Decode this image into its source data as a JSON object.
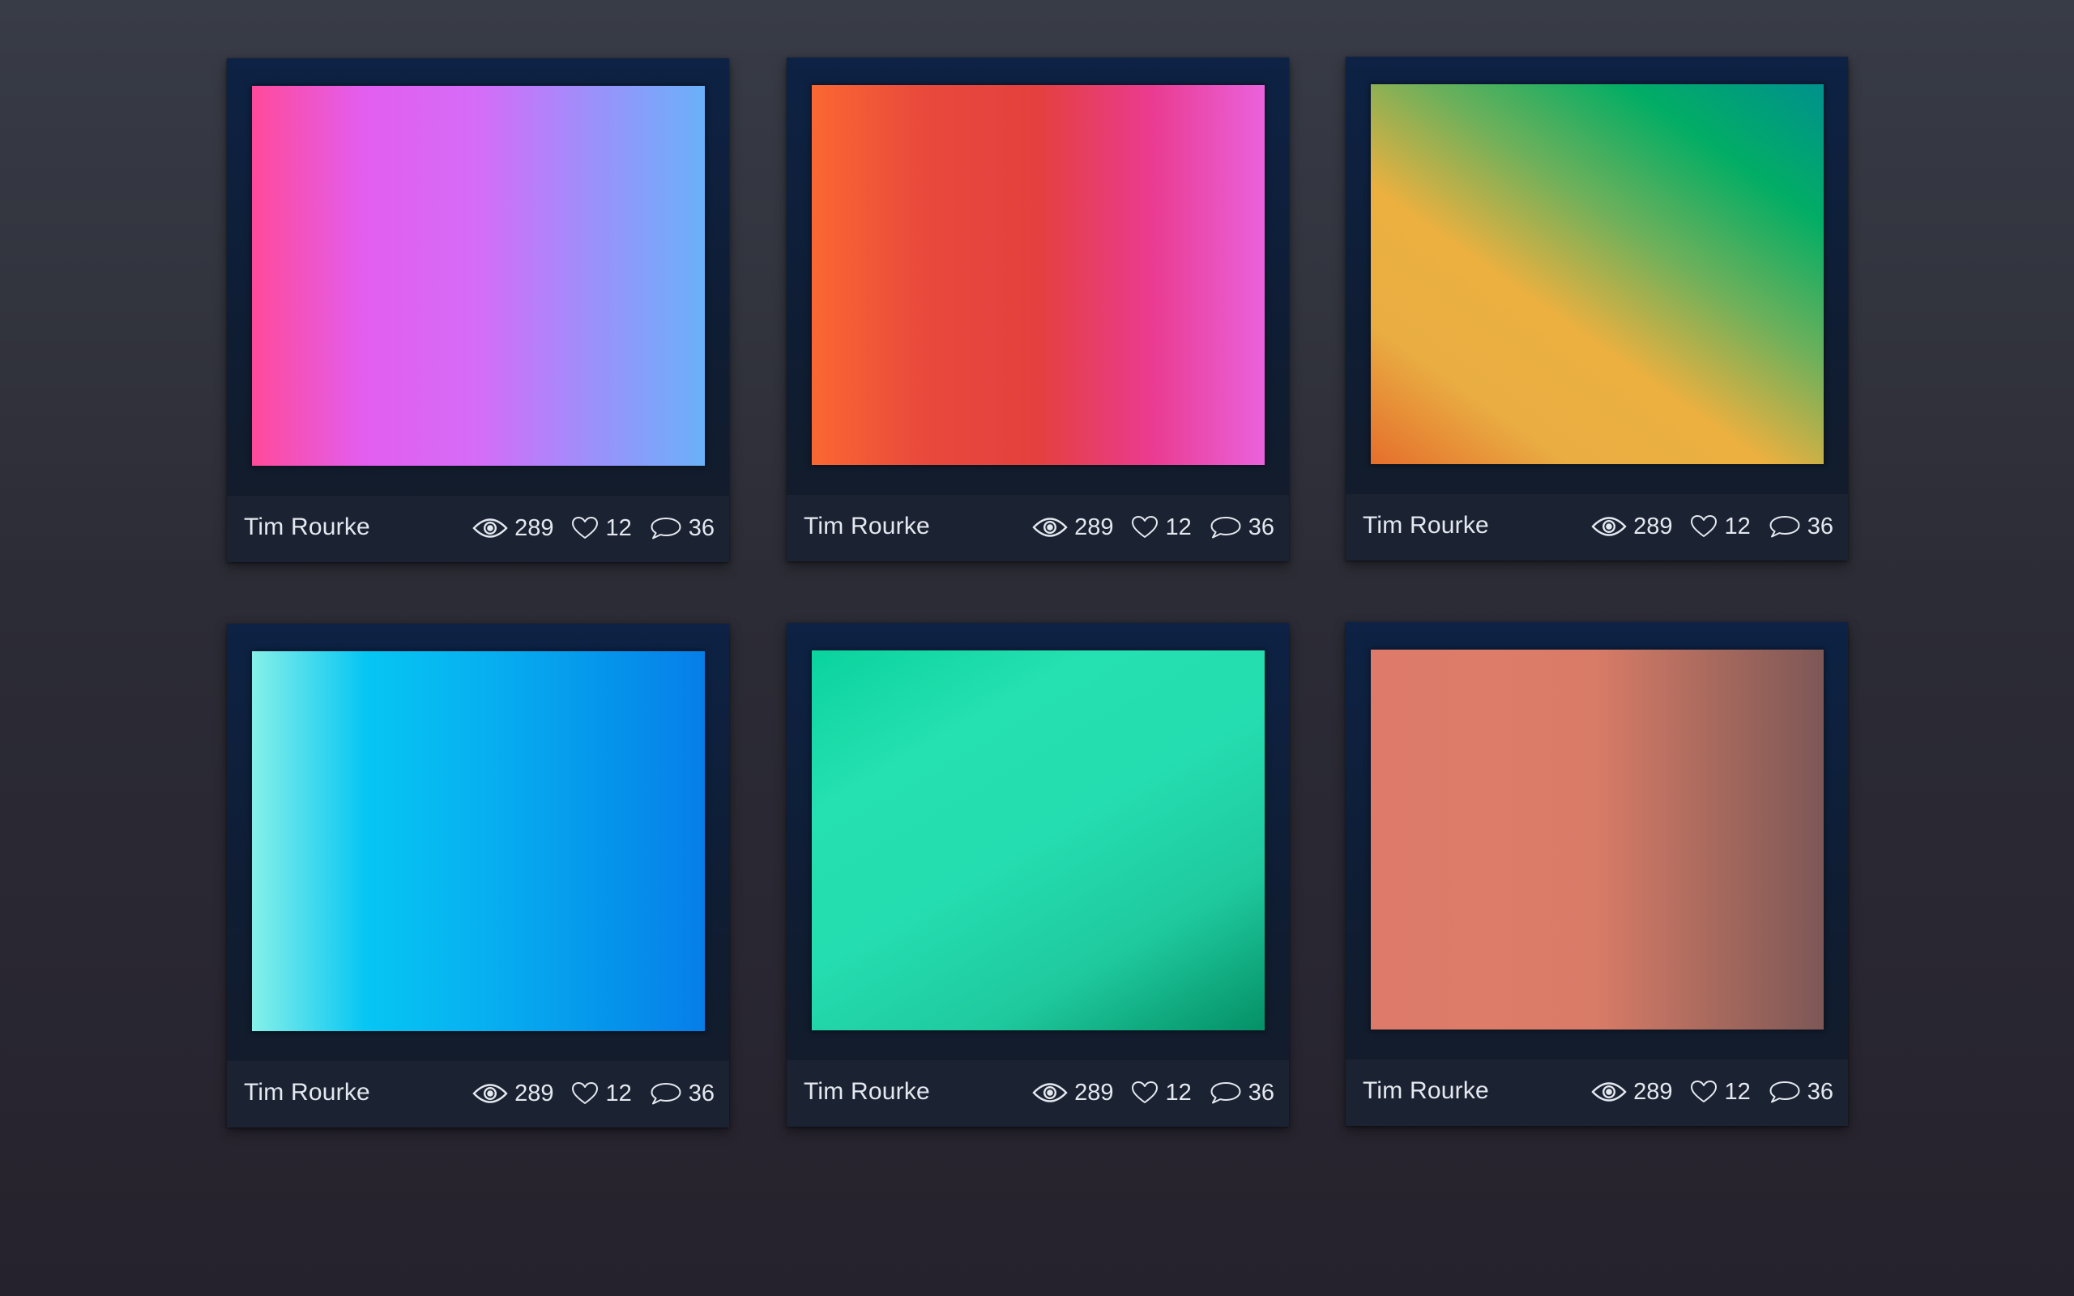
{
  "cards": [
    {
      "author": "Tim Rourke",
      "views": "289",
      "likes": "12",
      "comments": "36",
      "gradient": {
        "angle": "90deg",
        "colors": [
          "#ff4a9a",
          "#e25ef0",
          "#d56cf7",
          "#9c90fb",
          "#6ab1f9"
        ]
      }
    },
    {
      "author": "Tim Rourke",
      "views": "289",
      "likes": "12",
      "comments": "36",
      "gradient": {
        "angle": "90deg",
        "colors": [
          "#fb6733",
          "#e8493c",
          "#e4403f",
          "#ea3b90",
          "#ea62dd"
        ]
      }
    },
    {
      "author": "Tim Rourke",
      "views": "289",
      "likes": "12",
      "comments": "36",
      "gradient": {
        "angle": "35deg",
        "colors": [
          "#e56e2c",
          "#e9ad42",
          "#ebb040",
          "#6db05b",
          "#02ad65",
          "#00918d"
        ]
      }
    },
    {
      "author": "Tim Rourke",
      "views": "289",
      "likes": "12",
      "comments": "36",
      "gradient": {
        "angle": "90deg",
        "colors": [
          "#86f0e8",
          "#06c6f3",
          "#07b1f0",
          "#0598ec",
          "#067ee9"
        ]
      }
    },
    {
      "author": "Tim Rourke",
      "views": "289",
      "likes": "12",
      "comments": "36",
      "gradient": {
        "angle": "150deg",
        "colors": [
          "#0ad39e",
          "#25e0b0",
          "#24ddb0",
          "#1fc99e",
          "#059066"
        ]
      }
    },
    {
      "author": "Tim Rourke",
      "views": "289",
      "likes": "12",
      "comments": "36",
      "gradient": {
        "angle": "90deg",
        "colors": [
          "#dd7a6a",
          "#dd7c69",
          "#d87b67",
          "#a96a5e",
          "#7d5756"
        ]
      }
    }
  ],
  "icons": {
    "views": "eye-icon",
    "likes": "heart-icon",
    "comments": "speech-bubble-icon"
  },
  "colors": {
    "page_bg_top": "#383c46",
    "page_bg_bottom": "#26222d",
    "card_frame": "#0d2244",
    "card_footer": "#1b2232",
    "text": "#e4e8ef"
  }
}
